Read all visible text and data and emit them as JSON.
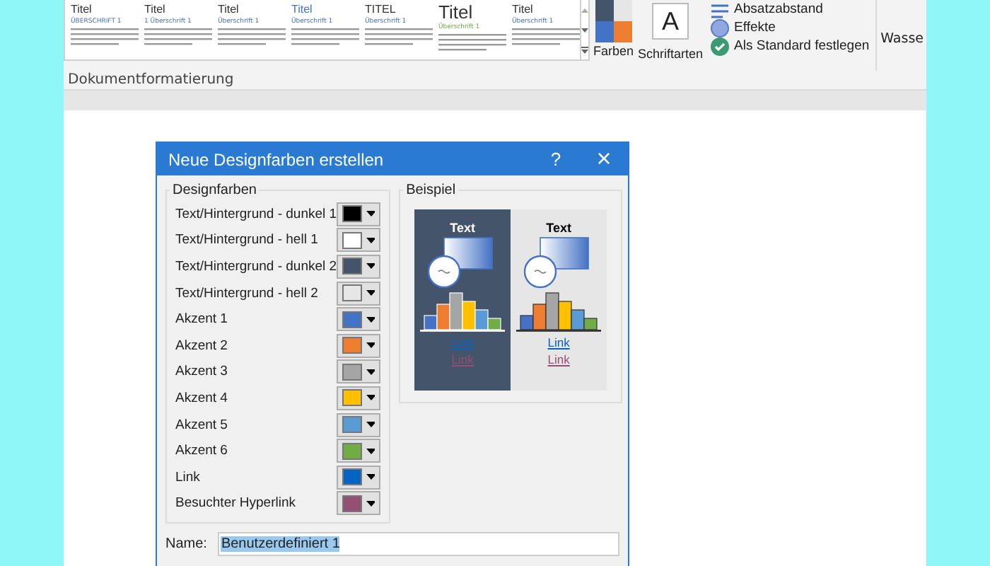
{
  "ribbon": {
    "styles": [
      {
        "title": "Titel",
        "heading": "ÜBERSCHRIFT 1"
      },
      {
        "title": "Titel",
        "heading": "1 Überschrift 1"
      },
      {
        "title": "Titel",
        "heading": "Überschrift 1"
      },
      {
        "title": "Titel",
        "heading": "Überschrift 1"
      },
      {
        "title": "TITEL",
        "heading": "Überschrift 1"
      },
      {
        "title": "Titel",
        "heading": "Überschrift 1"
      },
      {
        "title": "Titel",
        "heading": "Überschrift 1"
      }
    ],
    "colors_label": "Farben",
    "fonts_label": "Schriftarten",
    "fonts_glyph": "A",
    "commands": [
      {
        "kind": "spacing",
        "label": "Absatzabstand"
      },
      {
        "kind": "effects",
        "label": "Effekte"
      },
      {
        "kind": "default",
        "label": "Als Standard festlegen"
      }
    ],
    "watermark_label": "Wasse",
    "group_label": "Dokumentformatierung"
  },
  "dialog": {
    "title": "Neue Designfarben erstellen",
    "help": "?",
    "close": "×",
    "colors_group": "Designfarben",
    "colors": [
      {
        "label": "Text/Hintergrund - dunkel 1",
        "color": "#000000"
      },
      {
        "label": "Text/Hintergrund - hell 1",
        "color": "#ffffff"
      },
      {
        "label": "Text/Hintergrund - dunkel 2",
        "color": "#44546a"
      },
      {
        "label": "Text/Hintergrund - hell 2",
        "color": "#e7e6e6"
      },
      {
        "label": "Akzent 1",
        "color": "#4472c4"
      },
      {
        "label": "Akzent 2",
        "color": "#ed7d31"
      },
      {
        "label": "Akzent 3",
        "color": "#a5a5a5"
      },
      {
        "label": "Akzent 4",
        "color": "#ffc000"
      },
      {
        "label": "Akzent 5",
        "color": "#5b9bd5"
      },
      {
        "label": "Akzent 6",
        "color": "#70ad47"
      },
      {
        "label": "Link",
        "color": "#0563c1"
      },
      {
        "label": "Besuchter Hyperlink",
        "color": "#954f72"
      }
    ],
    "sample_group": "Beispiel",
    "samples": [
      {
        "heading": "Text",
        "link": "Link",
        "visited": "Link"
      },
      {
        "heading": "Text",
        "link": "Link",
        "visited": "Link"
      }
    ],
    "name_label": "Name:",
    "name_value": "Benutzerdefiniert 1"
  }
}
